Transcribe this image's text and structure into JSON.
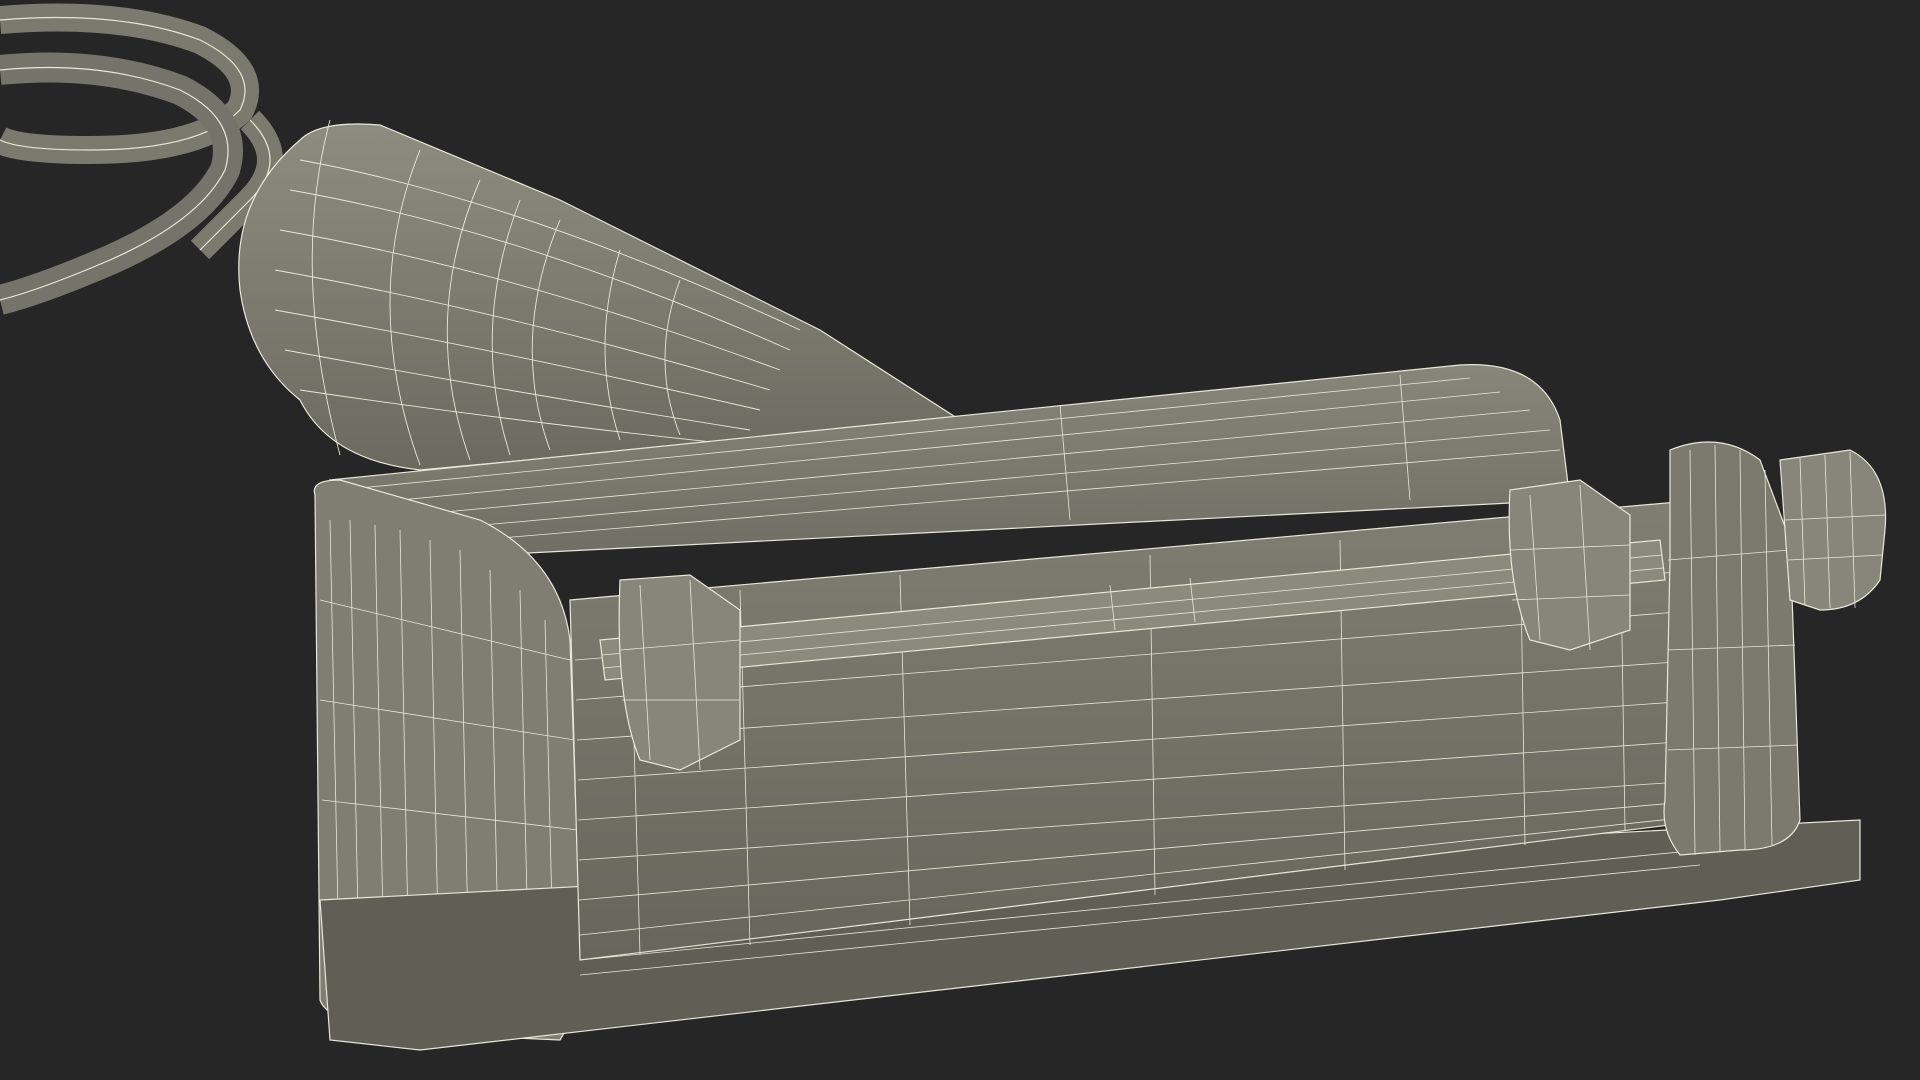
{
  "scene": {
    "subject": "wireframe-winch-model",
    "colors": {
      "background": "#262626",
      "surface": "#7a7a6e",
      "surface_light": "#8a8a7d",
      "surface_dark": "#5f5f55",
      "wire": "#e8e8d8"
    }
  }
}
